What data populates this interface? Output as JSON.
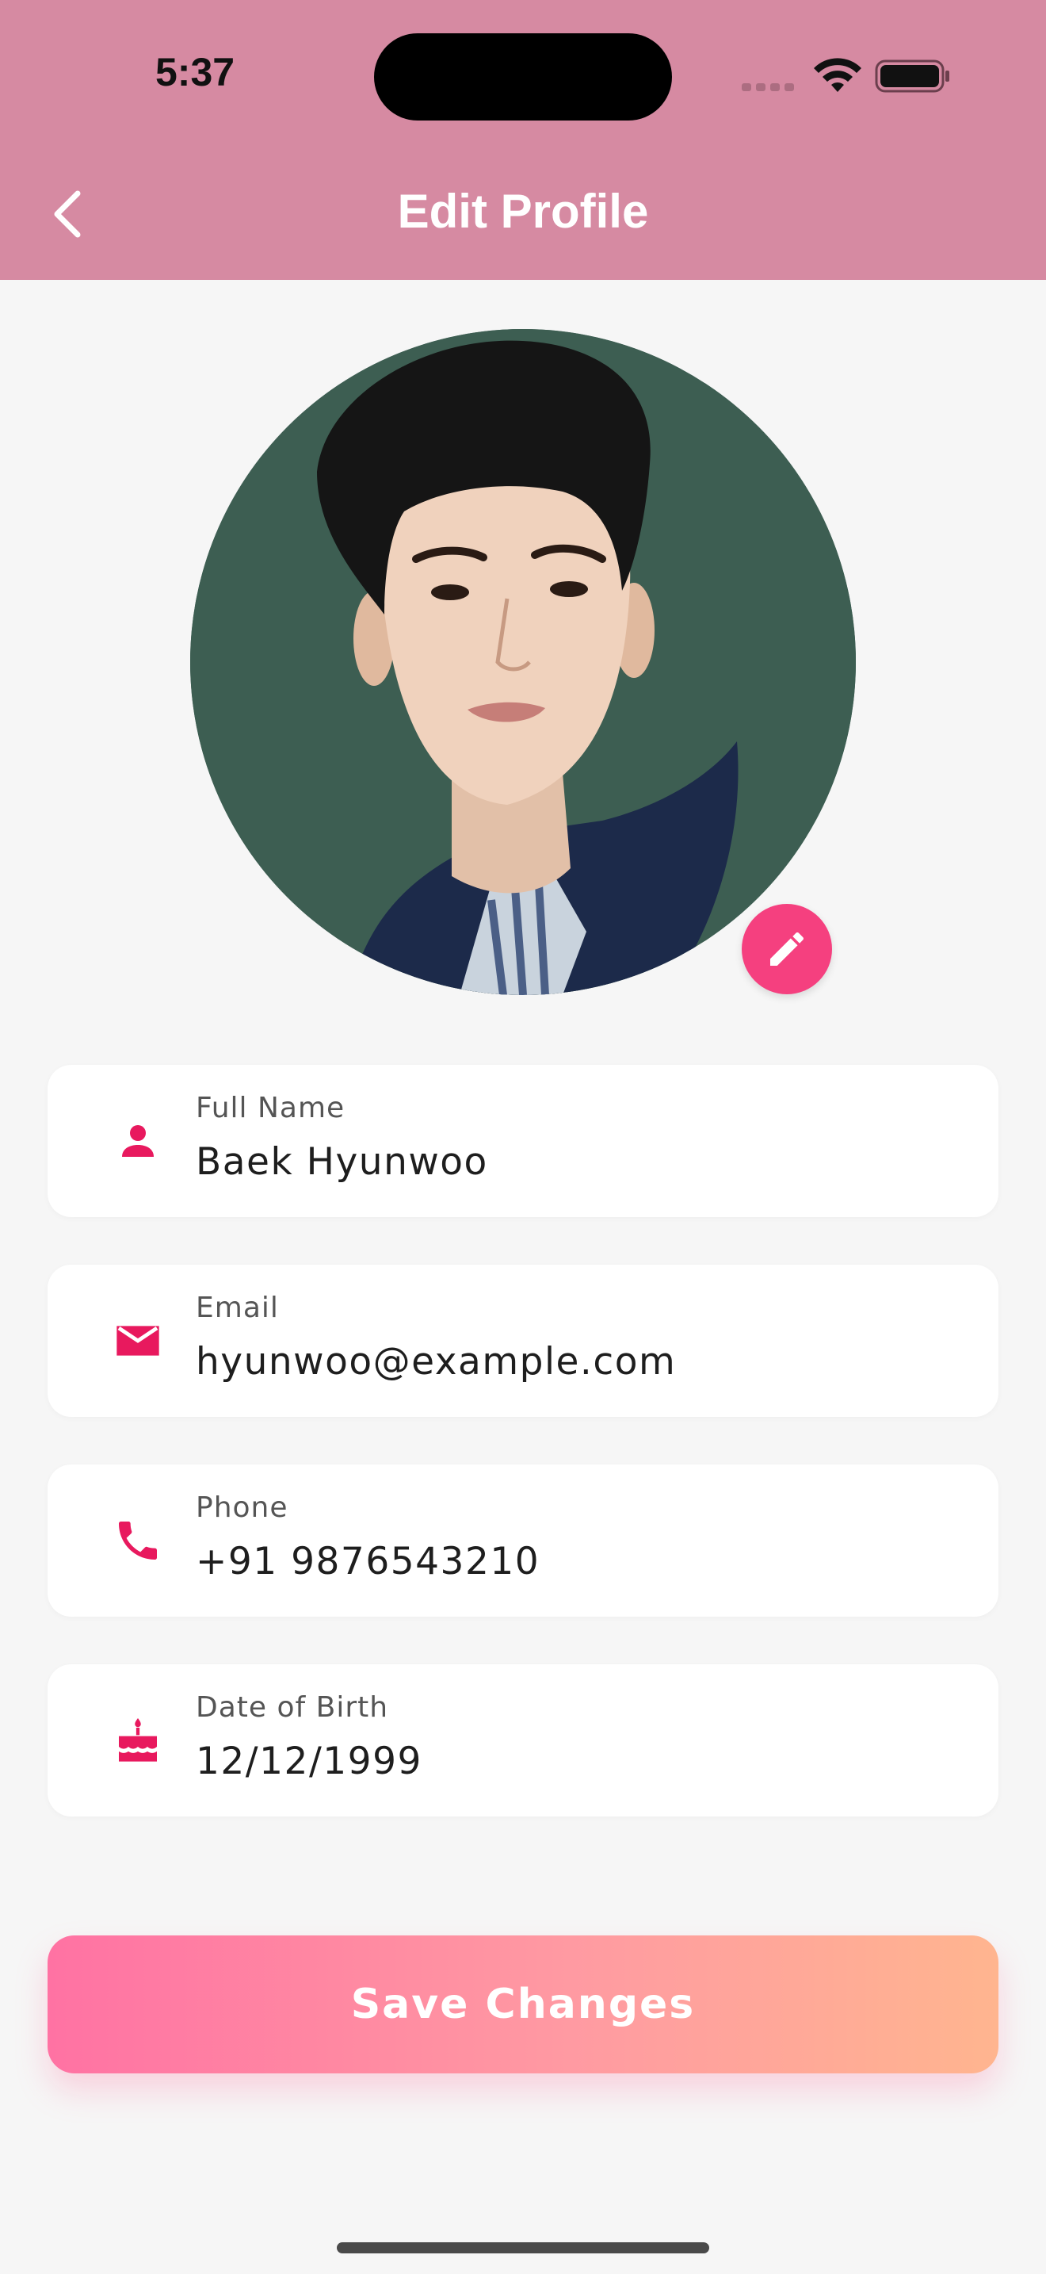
{
  "status_bar": {
    "time": "5:37"
  },
  "header": {
    "title": "Edit Profile",
    "background": "#d68aa2",
    "back_icon": "chevron-left-icon"
  },
  "profile": {
    "avatar_alt": "Profile photo",
    "edit_icon": "pencil-icon",
    "accent": "#f5407f"
  },
  "fields": [
    {
      "label": "Full Name",
      "value": "Baek Hyunwoo",
      "icon": "person-icon"
    },
    {
      "label": "Email",
      "value": "hyunwoo@example.com",
      "icon": "mail-icon"
    },
    {
      "label": "Phone",
      "value": "+91 9876543210",
      "icon": "phone-icon"
    },
    {
      "label": "Date of Birth",
      "value": "12/12/1999",
      "icon": "cake-icon"
    }
  ],
  "actions": {
    "save_label": "Save Changes"
  }
}
